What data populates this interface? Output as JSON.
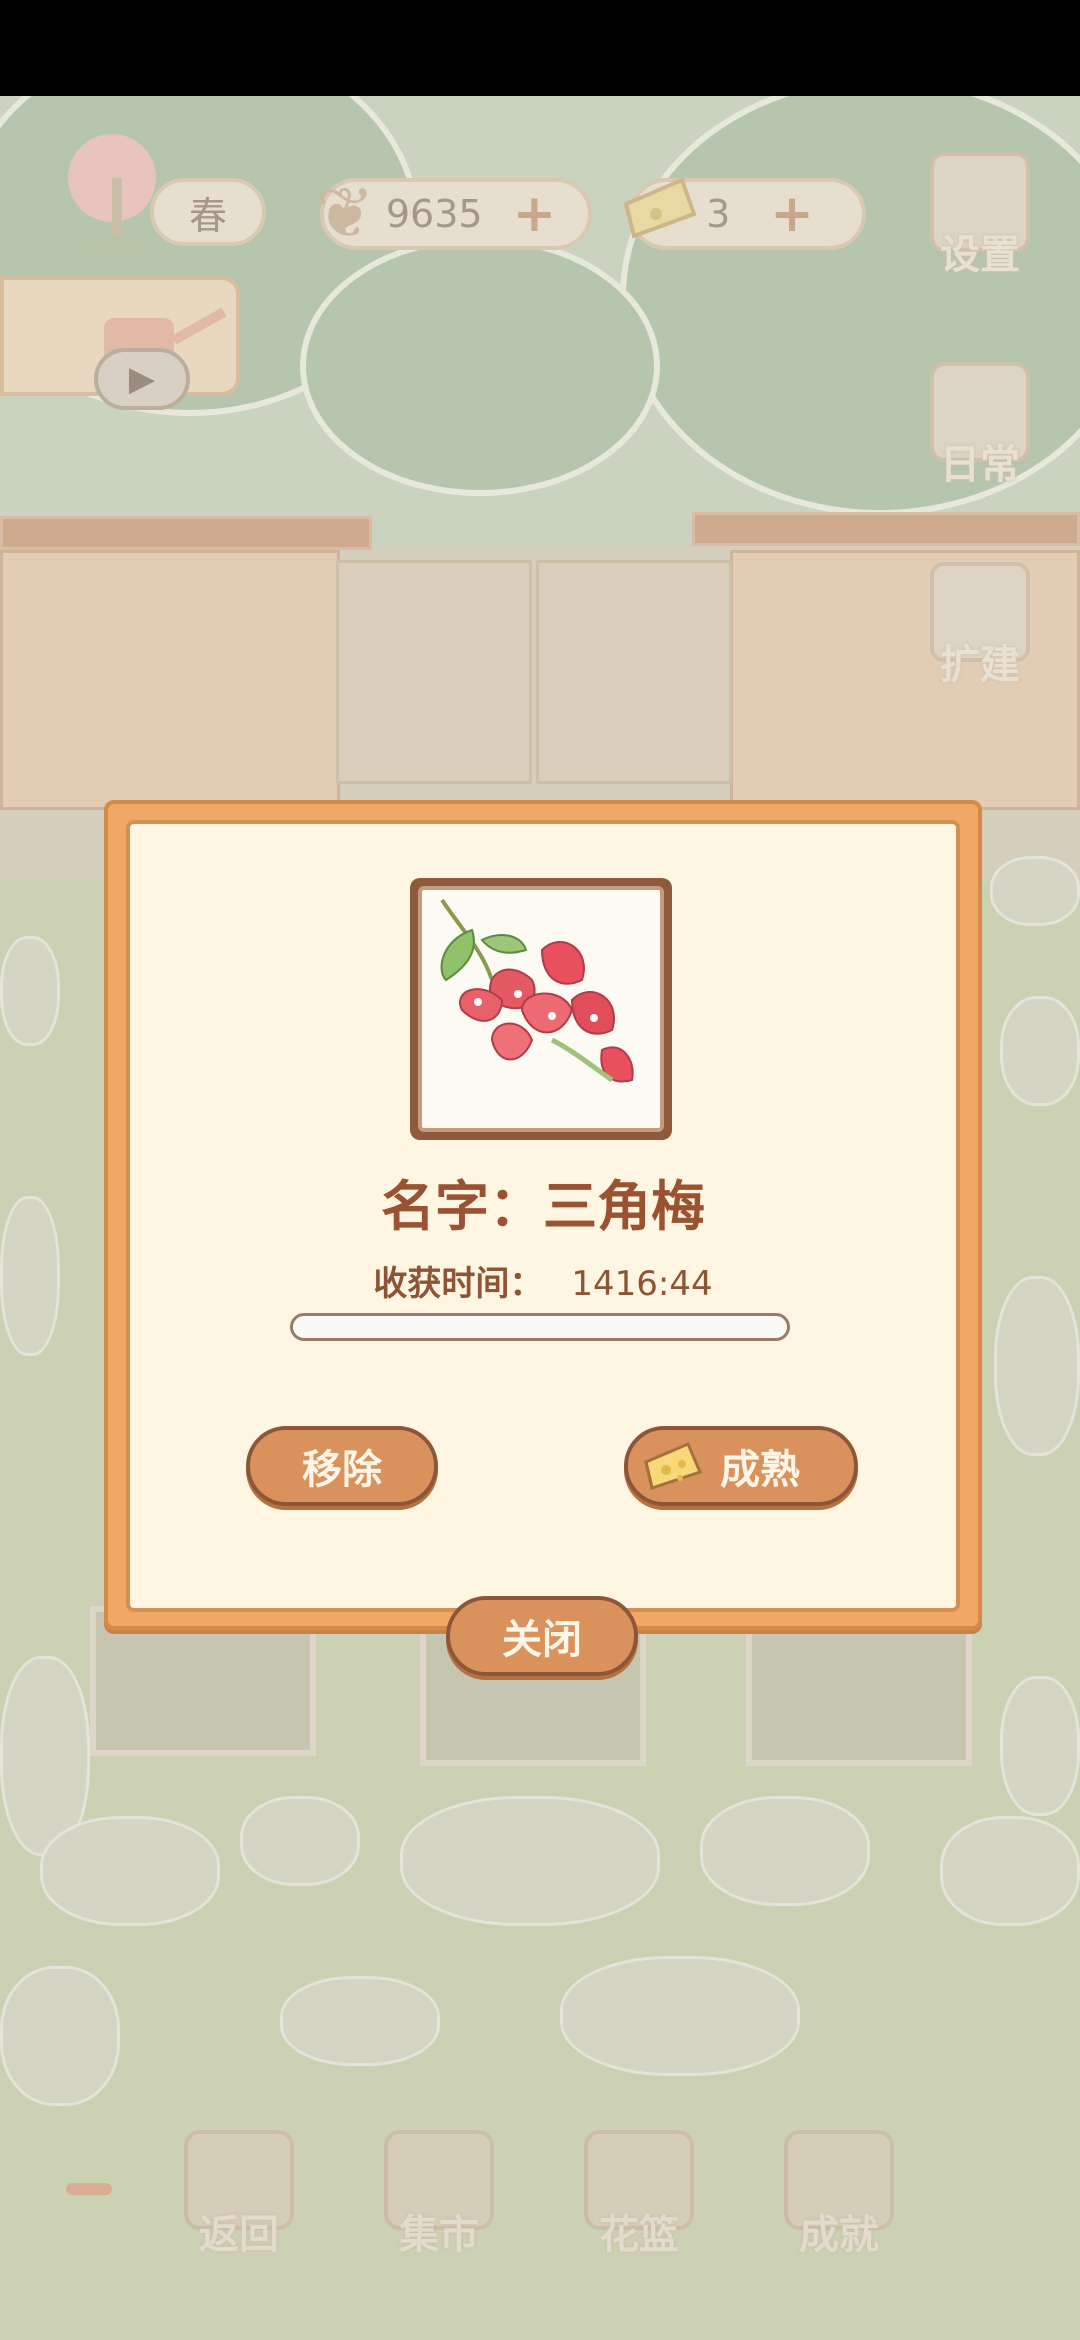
{
  "hud": {
    "season_label": "春",
    "fish_count": "9635",
    "cheese_count": "3",
    "plus_symbol": "+",
    "settings_label": "设置",
    "daily_label": "日常",
    "expand_label": "扩建"
  },
  "bottom_nav": {
    "items": [
      {
        "label": "返回",
        "icon": "window-icon"
      },
      {
        "label": "集市",
        "icon": "market-stall-icon"
      },
      {
        "label": "花篮",
        "icon": "flower-basket-icon"
      },
      {
        "label": "成就",
        "icon": "trophy-icon"
      }
    ]
  },
  "dialog": {
    "title": "名字：三角梅",
    "harvest_label": "收获时间：",
    "harvest_time": "1416:44",
    "progress": 0.0,
    "remove_label": "移除",
    "mature_label": "成熟",
    "close_label": "关闭",
    "flower_icon": "bougainvillea-icon",
    "mature_icon": "cheese-icon"
  },
  "colors": {
    "dialog_border": "#f0a864",
    "dialog_bg": "#fef6e2",
    "button_bg": "#d9925c",
    "title_color": "#9a5230"
  }
}
